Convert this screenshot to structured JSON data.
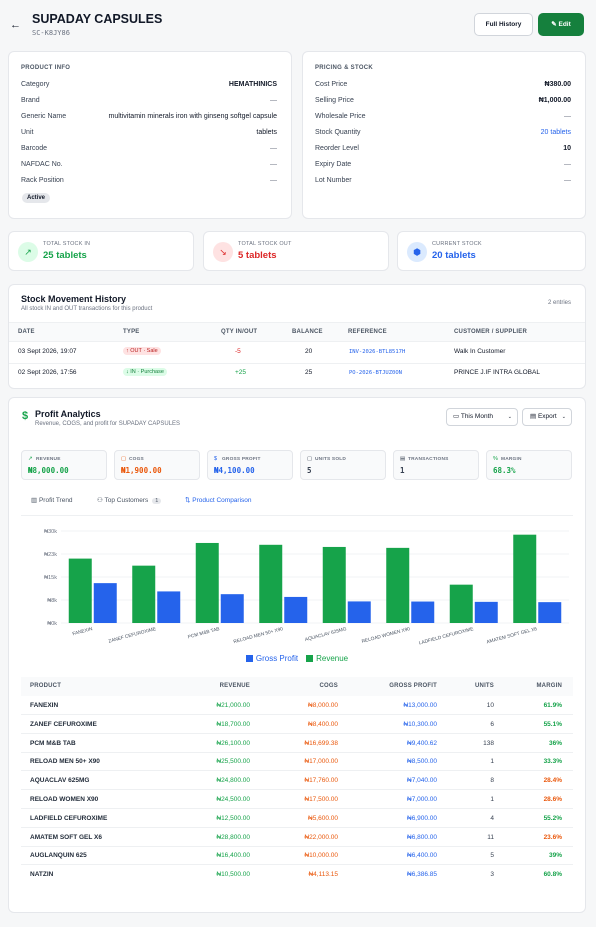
{
  "header": {
    "title": "SUPADAY CAPSULES",
    "code": "SC-K8JY86",
    "full_history": "Full History",
    "edit": "Edit"
  },
  "product_info": {
    "heading": "PRODUCT INFO",
    "rows": [
      {
        "label": "Category",
        "value": "HEMATHINICS"
      },
      {
        "label": "Brand",
        "value": "—"
      },
      {
        "label": "Generic Name",
        "value": "multivitamin minerals iron with ginseng softgel capsule"
      },
      {
        "label": "Unit",
        "value": "tablets"
      },
      {
        "label": "Barcode",
        "value": "—"
      },
      {
        "label": "NAFDAC No.",
        "value": "—"
      },
      {
        "label": "Rack Position",
        "value": "—"
      }
    ],
    "status": "Active"
  },
  "pricing": {
    "heading": "PRICING & STOCK",
    "rows": [
      {
        "label": "Cost Price",
        "value": "₦380.00"
      },
      {
        "label": "Selling Price",
        "value": "₦1,000.00"
      },
      {
        "label": "Wholesale Price",
        "value": "—"
      },
      {
        "label": "Stock Quantity",
        "value": "20 tablets"
      },
      {
        "label": "Reorder Level",
        "value": "10"
      },
      {
        "label": "Expiry Date",
        "value": "—"
      },
      {
        "label": "Lot Number",
        "value": "—"
      }
    ]
  },
  "stats": [
    {
      "label": "TOTAL STOCK IN",
      "value": "25 tablets",
      "color": "#16a34a"
    },
    {
      "label": "TOTAL STOCK OUT",
      "value": "5 tablets",
      "color": "#dc2626"
    },
    {
      "label": "CURRENT STOCK",
      "value": "20 tablets",
      "color": "#2563eb"
    }
  ],
  "movement": {
    "title": "Stock Movement History",
    "subtitle": "All stock IN and OUT transactions for this product",
    "count": "2 entries",
    "columns": [
      "DATE",
      "TYPE",
      "QTY IN/OUT",
      "BALANCE",
      "REFERENCE",
      "CUSTOMER / SUPPLIER"
    ],
    "rows": [
      {
        "date": "03 Sept 2026, 19:07",
        "type": "↑ OUT · Sale",
        "qty": "-5",
        "balance": "20",
        "reference": "INV-2026-BTL8517H",
        "party": "Walk In Customer"
      },
      {
        "date": "02 Sept 2026, 17:56",
        "type": "↓ IN · Purchase",
        "qty": "+25",
        "balance": "25",
        "reference": "PO-2026-BTJUZ0ON",
        "party": "PRINCE J.IF INTRA GLOBAL"
      }
    ]
  },
  "analytics": {
    "title": "Profit Analytics",
    "subtitle": "Revenue, COGS, and profit for SUPADAY CAPSULES",
    "period": "This Month",
    "export": "Export",
    "kpis": [
      {
        "label": "REVENUE",
        "value": "₦8,000.00",
        "color": "#16a34a"
      },
      {
        "label": "COGS",
        "value": "₦1,900.00",
        "color": "#ea580c"
      },
      {
        "label": "GROSS PROFIT",
        "value": "₦4,100.00",
        "color": "#2563eb"
      },
      {
        "label": "UNITS SOLD",
        "value": "5",
        "color": "#374151"
      },
      {
        "label": "TRANSACTIONS",
        "value": "1",
        "color": "#374151"
      },
      {
        "label": "MARGIN",
        "value": "68.3%",
        "color": "#16a34a"
      }
    ],
    "tabs": [
      {
        "label": "Profit Trend"
      },
      {
        "label": "Top Customers",
        "badge": "1"
      },
      {
        "label": "Product Comparison"
      }
    ],
    "table": {
      "columns": [
        "PRODUCT",
        "REVENUE",
        "COGS",
        "GROSS PROFIT",
        "UNITS",
        "MARGIN"
      ],
      "rows": [
        {
          "product": "FANEXIN",
          "revenue": "₦21,000.00",
          "cogs": "₦8,000.00",
          "profit": "₦13,000.00",
          "units": "10",
          "margin": "61.9%",
          "mc": "#16a34a"
        },
        {
          "product": "ZANEF CEFUROXIME",
          "revenue": "₦18,700.00",
          "cogs": "₦8,400.00",
          "profit": "₦10,300.00",
          "units": "6",
          "margin": "55.1%",
          "mc": "#16a34a"
        },
        {
          "product": "PCM M&B TAB",
          "revenue": "₦26,100.00",
          "cogs": "₦16,699.38",
          "profit": "₦9,400.62",
          "units": "138",
          "margin": "36%",
          "mc": "#16a34a"
        },
        {
          "product": "RELOAD MEN 50+ X90",
          "revenue": "₦25,500.00",
          "cogs": "₦17,000.00",
          "profit": "₦8,500.00",
          "units": "1",
          "margin": "33.3%",
          "mc": "#16a34a"
        },
        {
          "product": "AQUACLAV 625MG",
          "revenue": "₦24,800.00",
          "cogs": "₦17,760.00",
          "profit": "₦7,040.00",
          "units": "8",
          "margin": "28.4%",
          "mc": "#ea580c"
        },
        {
          "product": "RELOAD WOMEN X90",
          "revenue": "₦24,500.00",
          "cogs": "₦17,500.00",
          "profit": "₦7,000.00",
          "units": "1",
          "margin": "28.6%",
          "mc": "#ea580c"
        },
        {
          "product": "LADFIELD CEFUROXIME",
          "revenue": "₦12,500.00",
          "cogs": "₦5,600.00",
          "profit": "₦6,900.00",
          "units": "4",
          "margin": "55.2%",
          "mc": "#16a34a"
        },
        {
          "product": "AMATEM SOFT GEL X6",
          "revenue": "₦28,800.00",
          "cogs": "₦22,000.00",
          "profit": "₦6,800.00",
          "units": "11",
          "margin": "23.6%",
          "mc": "#ea580c"
        },
        {
          "product": "AUGLANQUIN 625",
          "revenue": "₦16,400.00",
          "cogs": "₦10,000.00",
          "profit": "₦6,400.00",
          "units": "5",
          "margin": "39%",
          "mc": "#16a34a"
        },
        {
          "product": "NATZIN",
          "revenue": "₦10,500.00",
          "cogs": "₦4,113.15",
          "profit": "₦6,386.85",
          "units": "3",
          "margin": "60.8%",
          "mc": "#16a34a"
        }
      ]
    }
  },
  "chart_data": {
    "type": "bar",
    "categories": [
      "FANEXIN",
      "ZANEF CEFUROXIME",
      "PCM M&B TAB",
      "RELOAD MEN 50+ X90",
      "AQUACLAV 625MG",
      "RELOAD WOMEN X90",
      "LADFIELD CEFUROXIME",
      "AMATEM SOFT GEL X6"
    ],
    "series": [
      {
        "name": "Gross Profit",
        "color": "#2563eb",
        "values": [
          13000,
          10300,
          9400.62,
          8500,
          7040,
          7000,
          6900,
          6800
        ]
      },
      {
        "name": "Revenue",
        "color": "#16a34a",
        "values": [
          21000,
          18700,
          26100,
          25500,
          24800,
          24500,
          12500,
          28800
        ]
      }
    ],
    "yticks": [
      "₦0k",
      "₦8k",
      "₦15k",
      "₦23k",
      "₦30k"
    ],
    "ylim": [
      0,
      30000
    ],
    "legend": "bottom"
  }
}
